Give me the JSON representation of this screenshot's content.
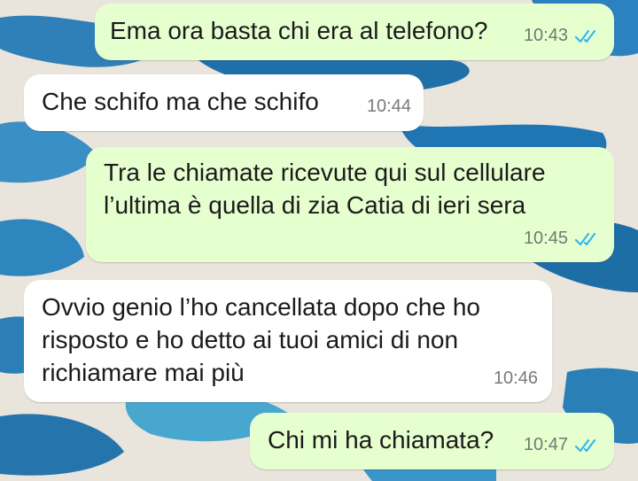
{
  "chat": {
    "colors": {
      "outgoing_bubble": "#e6ffcf",
      "incoming_bubble": "#ffffff",
      "read_ticks": "#34b7f1"
    },
    "messages": [
      {
        "direction": "out",
        "text": "Ema ora basta chi era al telefono?",
        "time": "10:43",
        "status": "read"
      },
      {
        "direction": "in",
        "text": "Che schifo ma che schifo",
        "time": "10:44"
      },
      {
        "direction": "out",
        "text": "Tra le chiamate ricevute qui sul cellulare\nl’ultima è quella di zia Catia di ieri sera",
        "time": "10:45",
        "status": "read"
      },
      {
        "direction": "in",
        "text": "Ovvio genio l’ho cancellata dopo che ho\nrisposto e ho detto ai tuoi amici di non\nrichiamare mai più",
        "time": "10:46"
      },
      {
        "direction": "out",
        "text": "Chi mi ha chiamata?",
        "time": "10:47",
        "status": "read"
      }
    ]
  }
}
